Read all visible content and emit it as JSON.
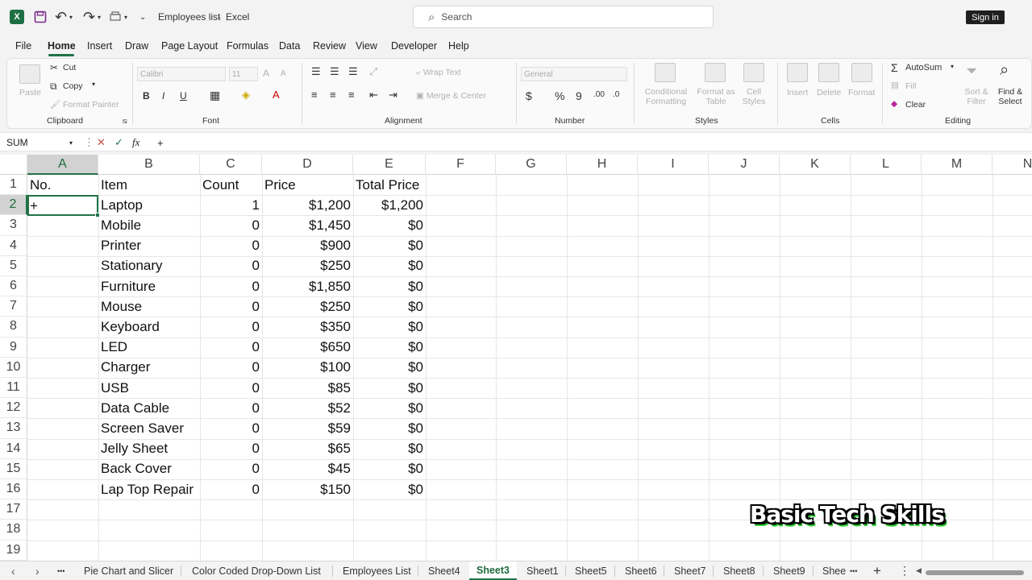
{
  "titlebar": {
    "logo": "X",
    "undo_icon": "↶",
    "redo_icon": "↷",
    "doc_title": "Employees list",
    "separator": "-",
    "app_name": "Excel",
    "search_placeholder": "Search",
    "search_icon": "⌕",
    "signin": "Sign in"
  },
  "menu": [
    "File",
    "Home",
    "Insert",
    "Draw",
    "Page Layout",
    "Formulas",
    "Data",
    "Review",
    "View",
    "Developer",
    "Help"
  ],
  "ribbon": {
    "clipboard": {
      "paste": "Paste",
      "cut": "Cut",
      "copy": "Copy",
      "format_painter": "Format Painter",
      "label": "Clipboard"
    },
    "font": {
      "font_name": "Calibri",
      "font_size": "11",
      "bold": "B",
      "italic": "I",
      "underline": "U",
      "label": "Font"
    },
    "alignment": {
      "wrap": "Wrap Text",
      "merge": "Merge & Center",
      "label": "Alignment"
    },
    "number": {
      "format": "General",
      "currency": "$",
      "percent": "%",
      "comma": "9",
      "label": "Number"
    },
    "styles": {
      "conditional_1": "Conditional",
      "conditional_2": "Formatting",
      "table_1": "Format as",
      "table_2": "Table",
      "cell_1": "Cell",
      "cell_2": "Styles",
      "label": "Styles"
    },
    "cells": {
      "insert": "Insert",
      "delete": "Delete",
      "format": "Format",
      "label": "Cells"
    },
    "editing": {
      "autosum": "AutoSum",
      "sigma": "Σ",
      "fill": "Fill",
      "clear": "Clear",
      "sort_1": "Sort &",
      "sort_2": "Filter",
      "find_1": "Find &",
      "find_2": "Select",
      "label": "Editing"
    }
  },
  "formula_bar": {
    "name_box": "SUM",
    "cancel": "✕",
    "enter": "✓",
    "fx": "fx",
    "content": "+"
  },
  "columns": [
    "A",
    "B",
    "C",
    "D",
    "E",
    "F",
    "G",
    "H",
    "I",
    "J",
    "K",
    "L",
    "M",
    "N"
  ],
  "row_numbers": [
    "1",
    "2",
    "3",
    "4",
    "5",
    "6",
    "7",
    "8",
    "9",
    "10",
    "11",
    "12",
    "13",
    "14",
    "15",
    "16",
    "17",
    "18",
    "19"
  ],
  "headers": {
    "no": "No.",
    "item": "Item",
    "count": "Count",
    "price": "Price",
    "total": "Total Price"
  },
  "active_cell_text": "+",
  "rows": [
    {
      "item": "Laptop",
      "count": "1",
      "price": "$1,200",
      "total": "$1,200"
    },
    {
      "item": "Mobile",
      "count": "0",
      "price": "$1,450",
      "total": "$0"
    },
    {
      "item": "Printer",
      "count": "0",
      "price": "$900",
      "total": "$0"
    },
    {
      "item": "Stationary",
      "count": "0",
      "price": "$250",
      "total": "$0"
    },
    {
      "item": "Furniture",
      "count": "0",
      "price": "$1,850",
      "total": "$0"
    },
    {
      "item": "Mouse",
      "count": "0",
      "price": "$250",
      "total": "$0"
    },
    {
      "item": "Keyboard",
      "count": "0",
      "price": "$350",
      "total": "$0"
    },
    {
      "item": "LED",
      "count": "0",
      "price": "$650",
      "total": "$0"
    },
    {
      "item": "Charger",
      "count": "0",
      "price": "$100",
      "total": "$0"
    },
    {
      "item": "USB",
      "count": "0",
      "price": "$85",
      "total": "$0"
    },
    {
      "item": "Data Cable",
      "count": "0",
      "price": "$52",
      "total": "$0"
    },
    {
      "item": "Screen Saver",
      "count": "0",
      "price": "$59",
      "total": "$0"
    },
    {
      "item": "Jelly Sheet",
      "count": "0",
      "price": "$65",
      "total": "$0"
    },
    {
      "item": "Back Cover",
      "count": "0",
      "price": "$45",
      "total": "$0"
    },
    {
      "item": "Lap Top Repair",
      "count": "0",
      "price": "$150",
      "total": "$0"
    }
  ],
  "sheet_tabs": [
    "Pie Chart and Slicer",
    "Color Coded Drop-Down List",
    "Employees List",
    "Sheet4",
    "Sheet3",
    "Sheet1",
    "Sheet5",
    "Sheet6",
    "Sheet7",
    "Sheet8",
    "Sheet9",
    "Shee"
  ],
  "active_sheet": "Sheet3",
  "tab_nav": {
    "prev": "‹",
    "next": "›",
    "more": "•••",
    "more2": "•••",
    "add": "+",
    "menu": "⋮",
    "scroll_left": "◀"
  },
  "watermark": "Basic Tech Skills",
  "accent_color": "#217346"
}
